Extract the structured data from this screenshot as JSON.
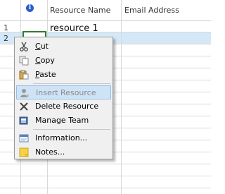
{
  "header": {
    "info_icon": "info-icon",
    "col_resource_name": "Resource Name",
    "col_email": "Email Address"
  },
  "rows": [
    {
      "number": "1",
      "resource_name": "resource 1"
    },
    {
      "number": "2",
      "resource_name": ""
    }
  ],
  "context_menu": {
    "items": [
      {
        "label_prefix": "",
        "label_ul": "C",
        "label_rest": "ut",
        "icon": "scissors-icon",
        "enabled": true
      },
      {
        "label_prefix": "",
        "label_ul": "C",
        "label_rest": "opy",
        "icon": "copy-icon",
        "enabled": true
      },
      {
        "label_prefix": "",
        "label_ul": "P",
        "label_rest": "aste",
        "icon": "paste-icon",
        "enabled": true
      },
      {
        "label": "Insert Resource",
        "icon": "insert-resource-icon",
        "enabled": false,
        "hovered": true
      },
      {
        "label": "Delete Resource",
        "icon": "delete-x-icon",
        "enabled": true
      },
      {
        "label": "Manage Team",
        "icon": "manage-team-icon",
        "enabled": true
      },
      {
        "label": "Information...",
        "icon": "information-icon",
        "enabled": true
      },
      {
        "label": "Notes...",
        "icon": "notes-icon",
        "enabled": true
      }
    ]
  },
  "colors": {
    "hover_bg": "#cfe3f7",
    "selection_row": "#d4e8f7",
    "active_cell_border": "#2e7d32",
    "info_blue": "#2c5ec8"
  }
}
